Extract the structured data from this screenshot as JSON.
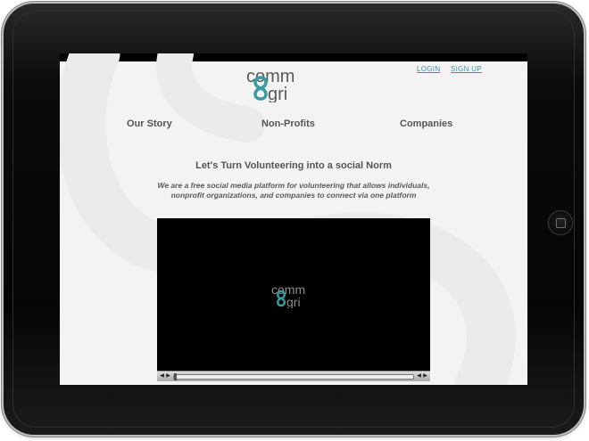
{
  "site": {
    "logo_top": "comm",
    "logo_bottom": "gri",
    "login_label": "LOGIN",
    "signup_label": "SIGN UP"
  },
  "nav": {
    "items": [
      {
        "label": "Our Story"
      },
      {
        "label": "Non-Profits"
      },
      {
        "label": "Companies"
      }
    ]
  },
  "hero": {
    "headline": "Let's Turn Volunteering into a social Norm",
    "tagline": "We are a free social media platform for volunteering that allows individuals, nonprofit organizations, and companies to connect via one platform"
  },
  "video": {
    "logo_top": "comm",
    "logo_bottom": "gri",
    "progress": 0
  },
  "colors": {
    "accent": "#3a9aa0",
    "logo_text": "#595959",
    "screen_bg": "#f3f3f3"
  },
  "icons": {
    "rewind": "rewind-icon",
    "play": "play-icon",
    "volume_down": "volume-down-icon",
    "volume_up": "volume-up-icon"
  }
}
